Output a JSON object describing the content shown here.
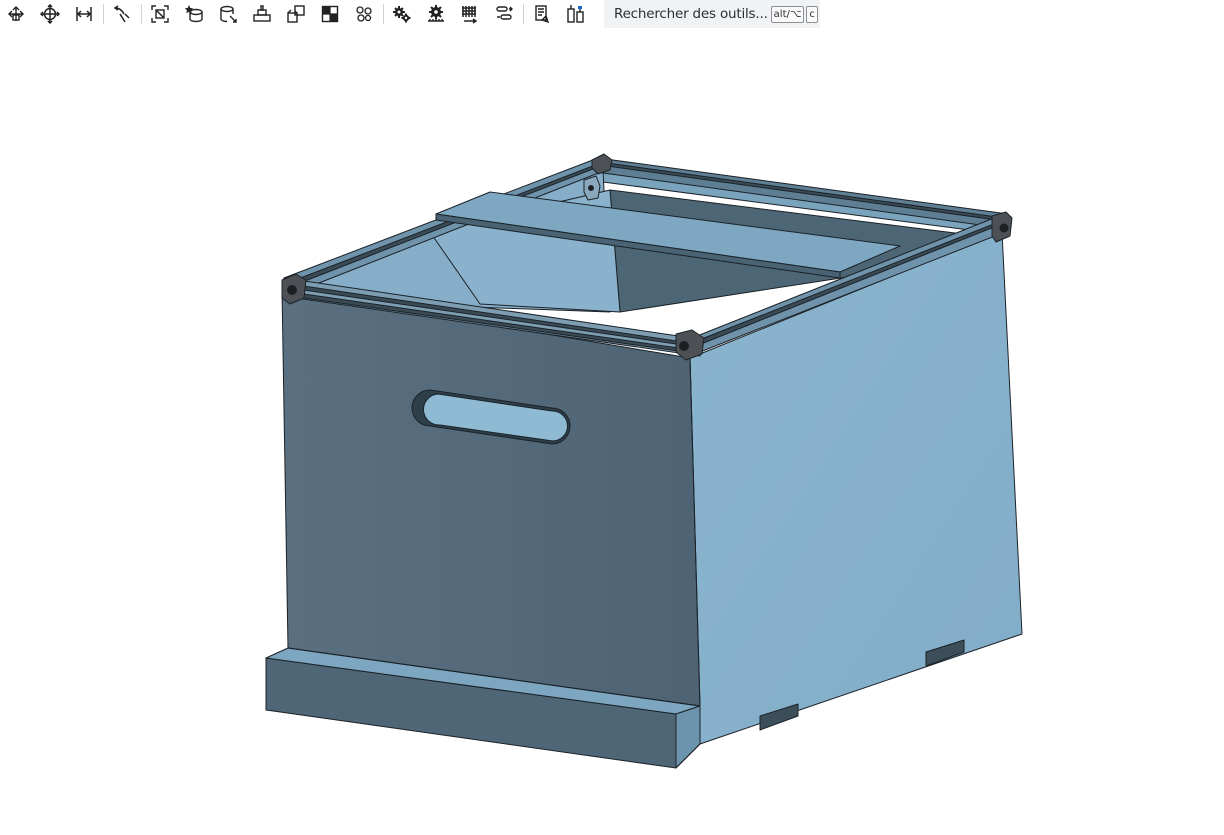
{
  "toolbar": {
    "tools": [
      {
        "icon": "transform-icon"
      },
      {
        "icon": "move-icon"
      },
      {
        "icon": "mate-icon"
      },
      {
        "icon": "relation-icon"
      },
      {
        "icon": "fit-view-icon"
      },
      {
        "icon": "insert-part-icon"
      },
      {
        "icon": "cylinder-icon"
      },
      {
        "icon": "fastened-mate-icon"
      },
      {
        "icon": "group-icon"
      },
      {
        "icon": "layout-icon"
      },
      {
        "icon": "pattern-icon"
      },
      {
        "icon": "gear-relation-icon"
      },
      {
        "icon": "rack-pinion-icon"
      },
      {
        "icon": "screw-relation-icon"
      },
      {
        "icon": "linear-relation-icon"
      },
      {
        "icon": "section-view-icon"
      },
      {
        "icon": "explode-view-icon"
      }
    ],
    "search": {
      "placeholder": "Rechercher des outils...",
      "shortcut_1": "alt/⌥",
      "shortcut_2": "c"
    }
  },
  "viewport": {
    "model": "beehive-box-assembly",
    "colors": {
      "front_face": "#526878",
      "side_face": "#87b1cc",
      "top_edge": "#3c4c58",
      "frame_rail": "#6c8ea6",
      "corner_block": "#4d5155",
      "outline": "#1b2228"
    }
  }
}
